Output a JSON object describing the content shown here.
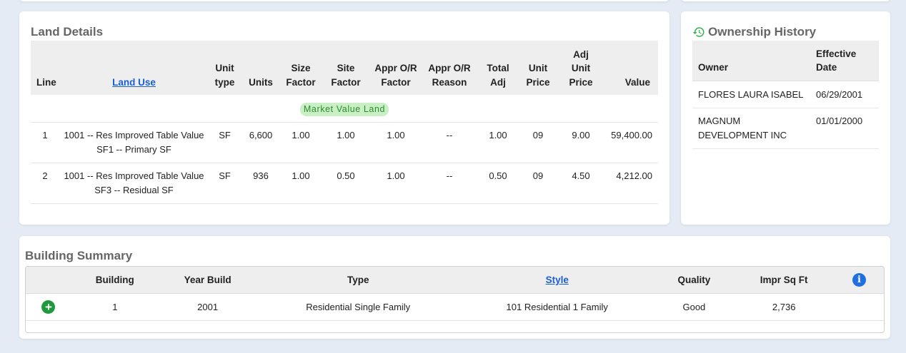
{
  "land_details": {
    "title": "Land Details",
    "columns": {
      "line": "Line",
      "land_use": "Land Use",
      "unit_type_1": "Unit",
      "unit_type_2": "type",
      "units": "Units",
      "size_factor_1": "Size",
      "size_factor_2": "Factor",
      "site_factor_1": "Site",
      "site_factor_2": "Factor",
      "appr_or_factor_1": "Appr O/R",
      "appr_or_factor_2": "Factor",
      "appr_or_reason_1": "Appr O/R",
      "appr_or_reason_2": "Reason",
      "total_adj_1": "Total",
      "total_adj_2": "Adj",
      "unit_price_1": "Unit",
      "unit_price_2": "Price",
      "adj_unit_price_1": "Adj",
      "adj_unit_price_2": "Unit",
      "adj_unit_price_3": "Price",
      "value": "Value"
    },
    "group_label": "Market Value Land",
    "rows": [
      {
        "line": "1",
        "land_use_1": "1001 -- Res Improved Table Value",
        "land_use_2": "SF1 -- Primary SF",
        "unit_type": "SF",
        "units": "6,600",
        "size_factor": "1.00",
        "site_factor": "1.00",
        "appr_or_factor": "1.00",
        "appr_or_reason": "--",
        "total_adj": "1.00",
        "unit_price": "09",
        "adj_unit_price": "9.00",
        "value": "59,400.00"
      },
      {
        "line": "2",
        "land_use_1": "1001 -- Res Improved Table Value",
        "land_use_2": "SF3 -- Residual SF",
        "unit_type": "SF",
        "units": "936",
        "size_factor": "1.00",
        "site_factor": "0.50",
        "appr_or_factor": "1.00",
        "appr_or_reason": "--",
        "total_adj": "0.50",
        "unit_price": "09",
        "adj_unit_price": "4.50",
        "value": "4,212.00"
      }
    ]
  },
  "ownership_history": {
    "title": "Ownership History",
    "icon": "history-icon",
    "icon_color": "#2fb54a",
    "columns": {
      "owner": "Owner",
      "effective_date_1": "Effective",
      "effective_date_2": "Date"
    },
    "rows": [
      {
        "owner_1": "FLORES LAURA ISABEL",
        "owner_2": "",
        "date": "06/29/2001"
      },
      {
        "owner_1": "MAGNUM",
        "owner_2": "DEVELOPMENT INC",
        "date": "01/01/2000"
      }
    ]
  },
  "building_summary": {
    "title": "Building Summary",
    "columns": {
      "building": "Building",
      "year_build": "Year Build",
      "type": "Type",
      "style": "Style",
      "quality": "Quality",
      "impr_sq_ft": "Impr Sq Ft"
    },
    "info_icon": "info-icon",
    "info_glyph": "i",
    "expand_icon": "plus-circle-icon",
    "expand_glyph": "+",
    "rows": [
      {
        "building": "1",
        "year_build": "2001",
        "type": "Residential Single Family",
        "style": "101 Residential 1 Family",
        "quality": "Good",
        "impr_sq_ft": "2,736"
      }
    ]
  },
  "colors": {
    "page_bg": "#e4ebf5",
    "link": "#1a5fd0",
    "badge_bg": "#c9f0c4",
    "badge_text": "#2f8a2f",
    "info_icon": "#1f6fe0",
    "expand_icon": "#1e9a3c"
  }
}
